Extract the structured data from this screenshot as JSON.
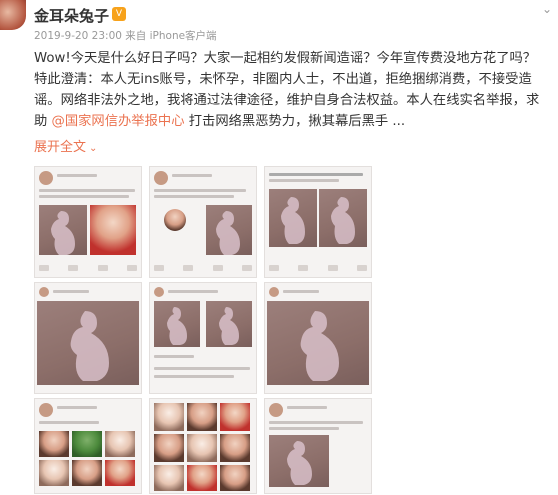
{
  "post": {
    "author": "金耳朵兔子",
    "meta": "2019-9-20 23:00 来自 iPhone客户端",
    "text_main": "Wow!今天是什么好日子吗？大家一起相约发假新闻造谣？今年宣传费没地方花了吗？特此澄清：本人无ins账号，未怀孕，非圈内人士，不出道，拒绝捆绑消费，不接受造谣。网络非法外之地，我将通过法律途径，维护自身合法权益。本人在线实名举报，求助 ",
    "mention": "@国家网信办举报中心",
    "text_end": " 打击网络黑恶势力，揪其幕后黑手 ...",
    "expand_label": "展开全文"
  },
  "colors": {
    "accent": "#eb7350",
    "vip": "#f7a21b"
  }
}
